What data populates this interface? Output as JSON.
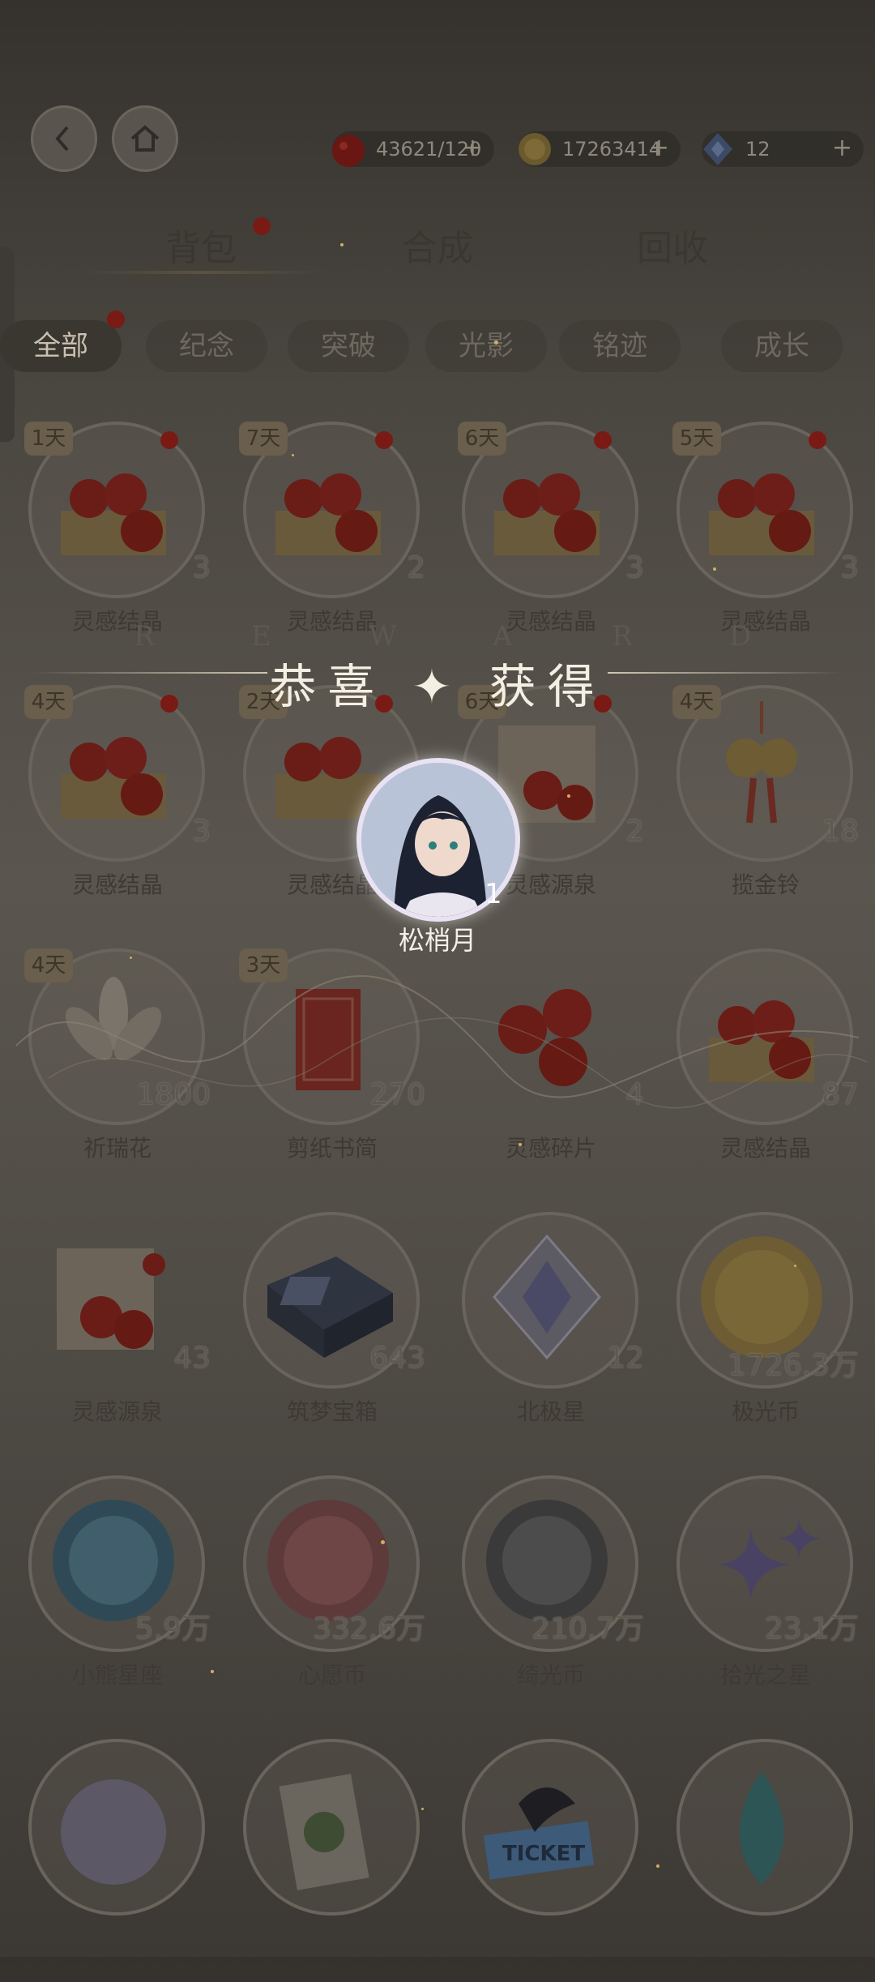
{
  "top_bar": {
    "back_label": "",
    "home_label": "",
    "resources": [
      {
        "icon": "apple-icon",
        "value": "43621/120",
        "plus": "+"
      },
      {
        "icon": "gold-coin-icon",
        "value": "17263414",
        "plus": "+"
      },
      {
        "icon": "star-ticket-icon",
        "value": "12",
        "plus": "+"
      }
    ]
  },
  "tabs": [
    {
      "label": "背包",
      "active": true
    },
    {
      "label": "合成",
      "active": false
    },
    {
      "label": "回收",
      "active": false
    }
  ],
  "chips": [
    {
      "label": "全部",
      "active": true
    },
    {
      "label": "纪念",
      "active": false
    },
    {
      "label": "突破",
      "active": false
    },
    {
      "label": "光影",
      "active": false
    },
    {
      "label": "铭迹",
      "active": false
    },
    {
      "label": "成长",
      "active": false
    }
  ],
  "items": [
    {
      "tag": "1天",
      "count": "3",
      "name": "灵感结晶",
      "art": "apple-crate",
      "dot": true
    },
    {
      "tag": "7天",
      "count": "2",
      "name": "灵感结晶",
      "art": "apple-crate",
      "dot": true
    },
    {
      "tag": "6天",
      "count": "3",
      "name": "灵感结晶",
      "art": "apple-crate",
      "dot": true
    },
    {
      "tag": "5天",
      "count": "3",
      "name": "灵感结晶",
      "art": "apple-crate",
      "dot": true
    },
    {
      "tag": "4天",
      "count": "3",
      "name": "灵感结晶",
      "art": "apple-crate",
      "dot": true
    },
    {
      "tag": "2天",
      "count": "",
      "name": "灵感结晶",
      "art": "apple-crate",
      "dot": true
    },
    {
      "tag": "6天",
      "count": "2",
      "name": "灵感源泉",
      "art": "apple-box",
      "dot": true
    },
    {
      "tag": "4天",
      "count": "18",
      "name": "揽金铃",
      "art": "golden-bell",
      "dot": false
    },
    {
      "tag": "4天",
      "count": "1800",
      "name": "祈瑞花",
      "art": "white-flower",
      "dot": false
    },
    {
      "tag": "3天",
      "count": "270",
      "name": "剪纸书简",
      "art": "paper-card",
      "dot": false
    },
    {
      "tag": "",
      "count": "4",
      "name": "灵感碎片",
      "art": "apples",
      "dot": false
    },
    {
      "tag": "",
      "count": "87",
      "name": "灵感结晶",
      "art": "apple-crate",
      "dot": false
    },
    {
      "tag": "",
      "count": "43",
      "name": "灵感源泉",
      "art": "apple-box",
      "dot": false
    },
    {
      "tag": "",
      "count": "643",
      "name": "筑梦宝箱",
      "art": "dark-box",
      "dot": false
    },
    {
      "tag": "",
      "count": "12",
      "name": "北极星",
      "art": "crystal",
      "dot": false
    },
    {
      "tag": "",
      "count": "1726.3万",
      "name": "极光币",
      "art": "gold-coin",
      "dot": false
    },
    {
      "tag": "",
      "count": "5.9万",
      "name": "小熊星座",
      "art": "blue-coin",
      "dot": false
    },
    {
      "tag": "",
      "count": "332.6万",
      "name": "心愿币",
      "art": "pink-coin",
      "dot": false
    },
    {
      "tag": "",
      "count": "210.7万",
      "name": "绮光币",
      "art": "silver-coin",
      "dot": false
    },
    {
      "tag": "",
      "count": "23.1万",
      "name": "拾光之星",
      "art": "purple-star",
      "dot": false
    },
    {
      "tag": "",
      "count": "",
      "name": "",
      "art": "silver-medal",
      "dot": false
    },
    {
      "tag": "",
      "count": "",
      "name": "",
      "art": "plant-card",
      "dot": false
    },
    {
      "tag": "",
      "count": "",
      "name": "",
      "art": "ticket",
      "dot": false
    },
    {
      "tag": "",
      "count": "",
      "name": "",
      "art": "teal-drop",
      "dot": false
    }
  ],
  "reward_popup": {
    "letters": [
      "R",
      "E",
      "W",
      "A",
      "R",
      "D"
    ],
    "title": "恭喜 ✦ 获得",
    "item_name": "松梢月",
    "item_count": "1",
    "item_icon": "character-portrait-icon"
  },
  "ticket_text": "TICKET",
  "colors": {
    "overlay": "#4a4640",
    "accent_gold": "#cfae6a",
    "red_dot": "#7a1a14"
  }
}
